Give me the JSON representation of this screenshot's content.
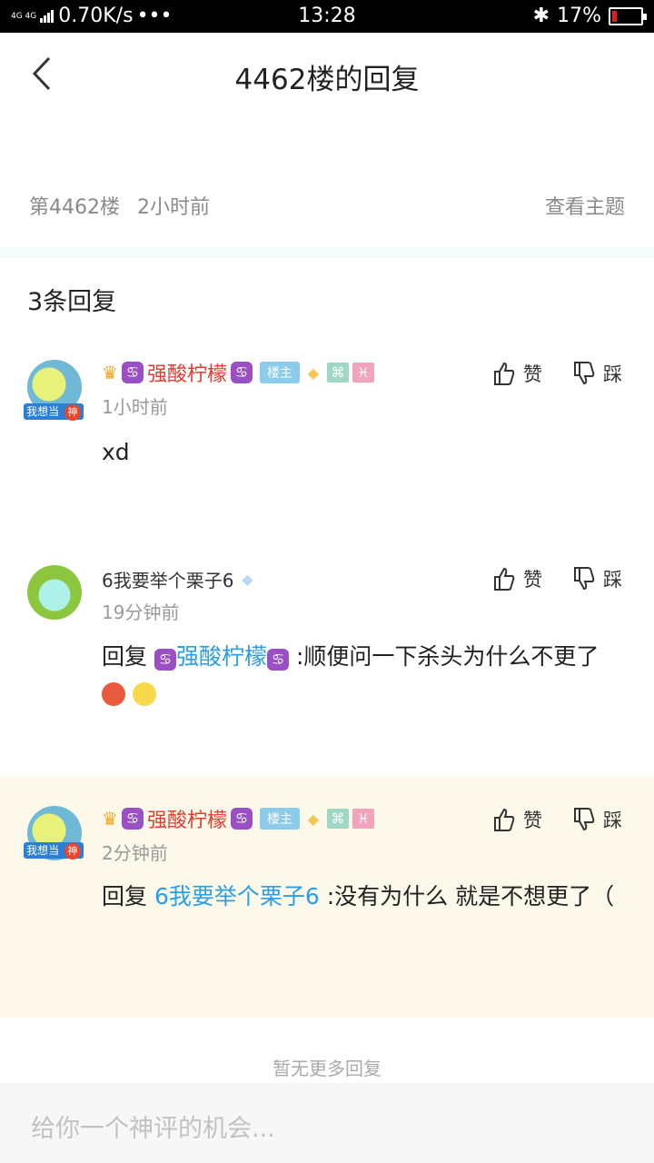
{
  "status_bar": {
    "network": "4G 4G",
    "speed": "0.70K/s",
    "dots": "•••",
    "time": "13:28",
    "bluetooth": "✱",
    "battery_text": "17%",
    "battery_level": 0.17
  },
  "nav": {
    "title": "4462楼的回复"
  },
  "floor": {
    "number": "第4462楼",
    "time": "2小时前",
    "view_topic": "查看主题"
  },
  "reply_count": "3条回复",
  "actions": {
    "like": "赞",
    "dislike": "踩"
  },
  "replies": [
    {
      "user": "强酸柠檬",
      "tag": "楼主",
      "time": "1小时前",
      "text": "xd"
    },
    {
      "user": "6我要举个栗子6",
      "time": "19分钟前",
      "prefix": "回复",
      "reply_to": "强酸柠檬",
      "text": ":顺便问一下杀头为什么不更了"
    },
    {
      "user": "强酸柠檬",
      "tag": "楼主",
      "time": "2分钟前",
      "prefix": "回复",
      "reply_to": "6我要举个栗子6",
      "text": ":没有为什么 就是不想更了（"
    }
  ],
  "no_more": "暂无更多回复",
  "input": {
    "placeholder": "给你一个神评的机会..."
  }
}
